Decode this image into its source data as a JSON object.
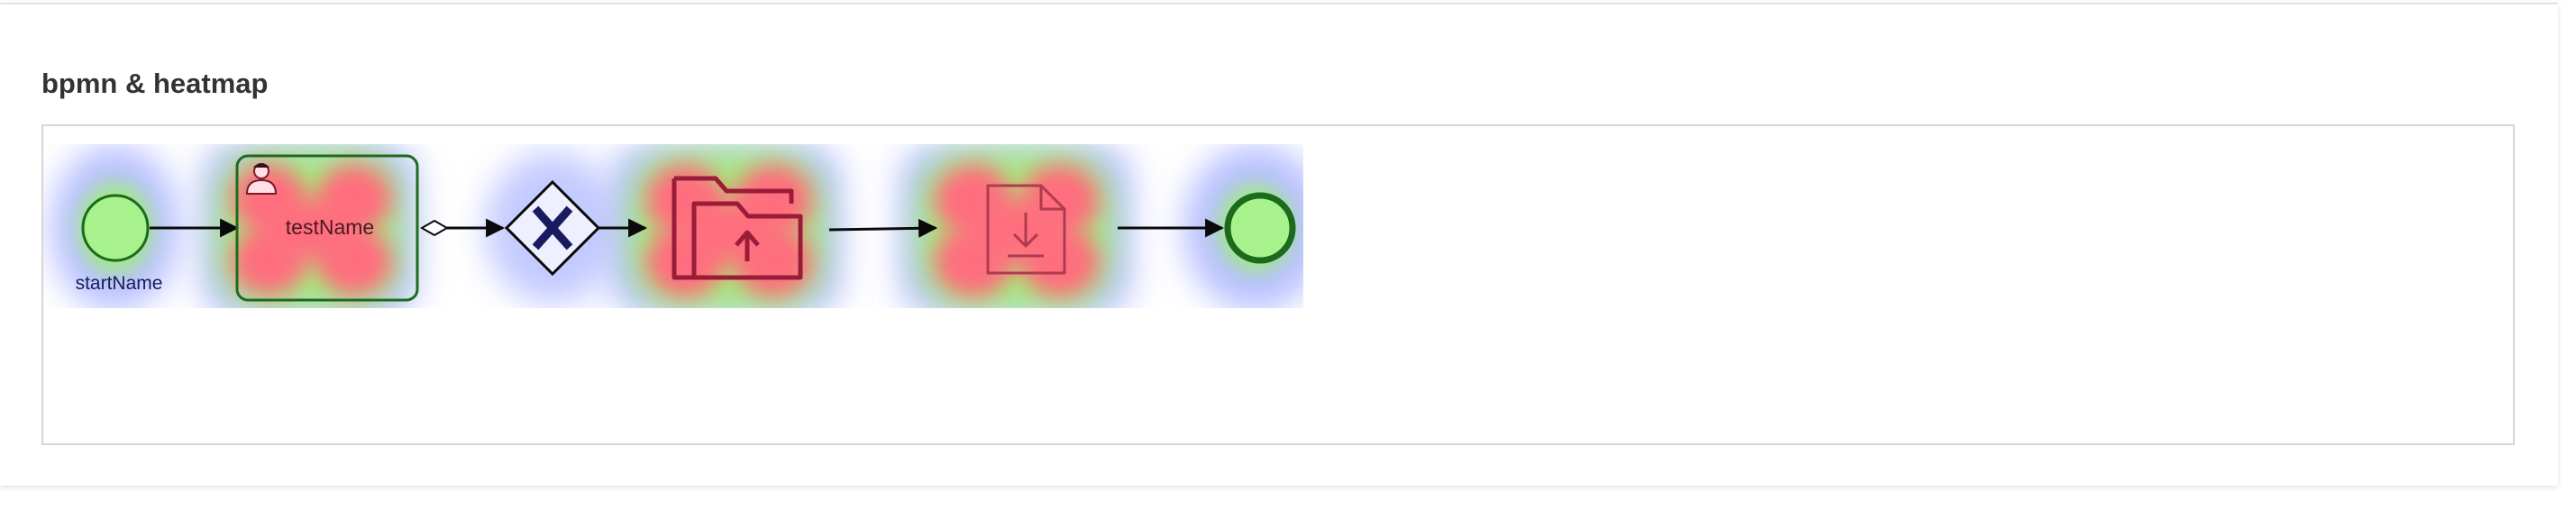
{
  "card": {
    "title": "bpmn & heatmap"
  },
  "diagram": {
    "start_event": {
      "label": "startName"
    },
    "user_task": {
      "label": "testName",
      "icon": "user-icon"
    },
    "gateway": {
      "type": "exclusive",
      "icon": "x-icon"
    },
    "upload_task": {
      "icon": "folder-upload-icon"
    },
    "download_task": {
      "icon": "file-download-icon"
    },
    "end_event": {}
  },
  "colors": {
    "heat_hot": "#ff6e7e",
    "heat_warm": "#9ef56a",
    "heat_cool": "#aab4ff",
    "event_fill": "#a8f28e",
    "event_stroke": "#1b6b1b",
    "task_stroke": "#1e6b1e",
    "icon_red": "#9a1c38",
    "label_navy": "#1a1a5e"
  }
}
